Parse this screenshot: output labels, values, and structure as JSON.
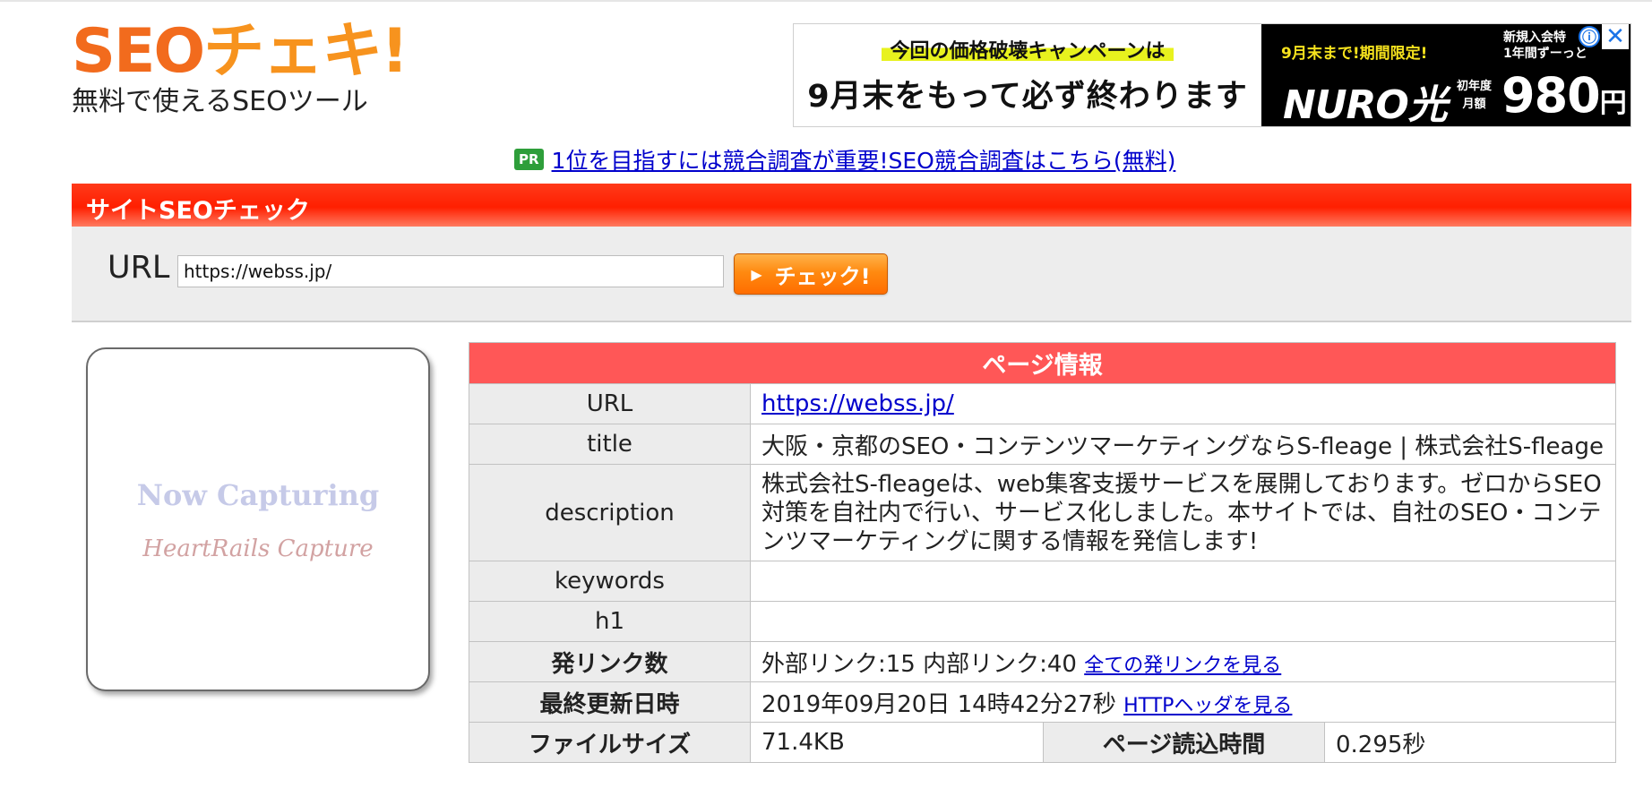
{
  "logo": {
    "title_latin": "SEO",
    "title_kana": "チェキ!",
    "subtitle": "無料で使えるSEOツール"
  },
  "ad": {
    "headline": "今回の価格破壊キャンペーンは",
    "main": "9月末をもって必ず終わります",
    "campaign": "9月末まで!期間限定!",
    "new_customer": "新規入会特",
    "new_customer2": "1年間ずーっと",
    "brand": "NURO光",
    "price_label1": "初年度",
    "price_label2": "月額",
    "price": "980",
    "yen": "円",
    "info_icon": "ⓘ",
    "close_icon": "✕"
  },
  "pr": {
    "badge": "PR",
    "link": "1位を目指すには競合調査が重要!SEO競合調査はこちら(無料)"
  },
  "section": {
    "title": "サイトSEOチェック"
  },
  "url_form": {
    "label": "URL",
    "value": "https://webss.jp/",
    "button": "チェック!"
  },
  "thumbnail": {
    "line1": "Now Capturing",
    "line2": "HeartRails Capture"
  },
  "page_info": {
    "header": "ページ情報",
    "url_label": "URL",
    "url_value": "https://webss.jp/",
    "title_label": "title",
    "title_value": "大阪・京都のSEO・コンテンツマーケティングならS-fleage | 株式会社S-fleage",
    "description_label": "description",
    "description_value": "株式会社S-fleageは、web集客支援サービスを展開しております。ゼロからSEO対策を自社内で行い、サービス化しました。本サイトでは、自社のSEO・コンテンツマーケティングに関する情報を発信します!",
    "keywords_label": "keywords",
    "keywords_value": "",
    "h1_label": "h1",
    "h1_value": "",
    "links_label": "発リンク数",
    "links_value": "外部リンク:15 内部リンク:40",
    "links_link": "全ての発リンクを見る",
    "updated_label": "最終更新日時",
    "updated_value": "2019年09月20日 14時42分27秒",
    "updated_link": "HTTPヘッダを見る",
    "filesize_label": "ファイルサイズ",
    "filesize_value": "71.4KB",
    "loadtime_label": "ページ読込時間",
    "loadtime_value": "0.295秒"
  }
}
